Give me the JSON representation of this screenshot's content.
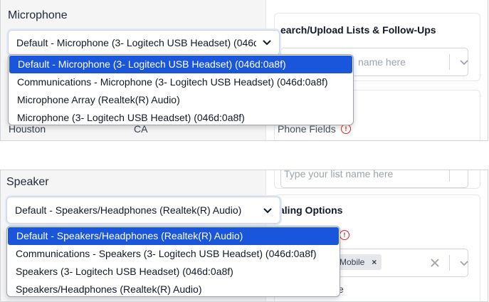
{
  "microphone": {
    "label": "Microphone",
    "selected_value": "Default - Microphone (3- Logitech USB Headset) (046d:0a8f)",
    "options": [
      "Default - Microphone (3- Logitech USB Headset) (046d:0a8f)",
      "Communications - Microphone (3- Logitech USB Headset) (046d:0a8f)",
      "Microphone Array (Realtek(R) Audio)",
      "Microphone (3- Logitech USB Headset) (046d:0a8f)"
    ]
  },
  "speaker": {
    "label": "Speaker",
    "selected_value": "Default - Speakers/Headphones (Realtek(R) Audio)",
    "options": [
      "Default - Speakers/Headphones (Realtek(R) Audio)",
      "Communications - Speakers (3- Logitech USB Headset) (046d:0a8f)",
      "Speakers (3- Logitech USB Headset) (046d:0a8f)",
      "Speakers/Headphones (Realtek(R) Audio)"
    ]
  },
  "background_top": {
    "city": "Houston",
    "state": "CA",
    "section_title": "earch/Upload Lists & Follow-Ups",
    "list_placeholder": "name here",
    "phone_fields_label": "Phone Fields"
  },
  "background_bottom": {
    "list_placeholder": "Type your list name here",
    "section_title": "aling Options",
    "chip_label": "Mobile",
    "trailing_text": "e"
  },
  "colors": {
    "selected_option_bg": "#1a56db",
    "focus_ring": "#e0e7ff",
    "required_icon": "#dc2626"
  }
}
